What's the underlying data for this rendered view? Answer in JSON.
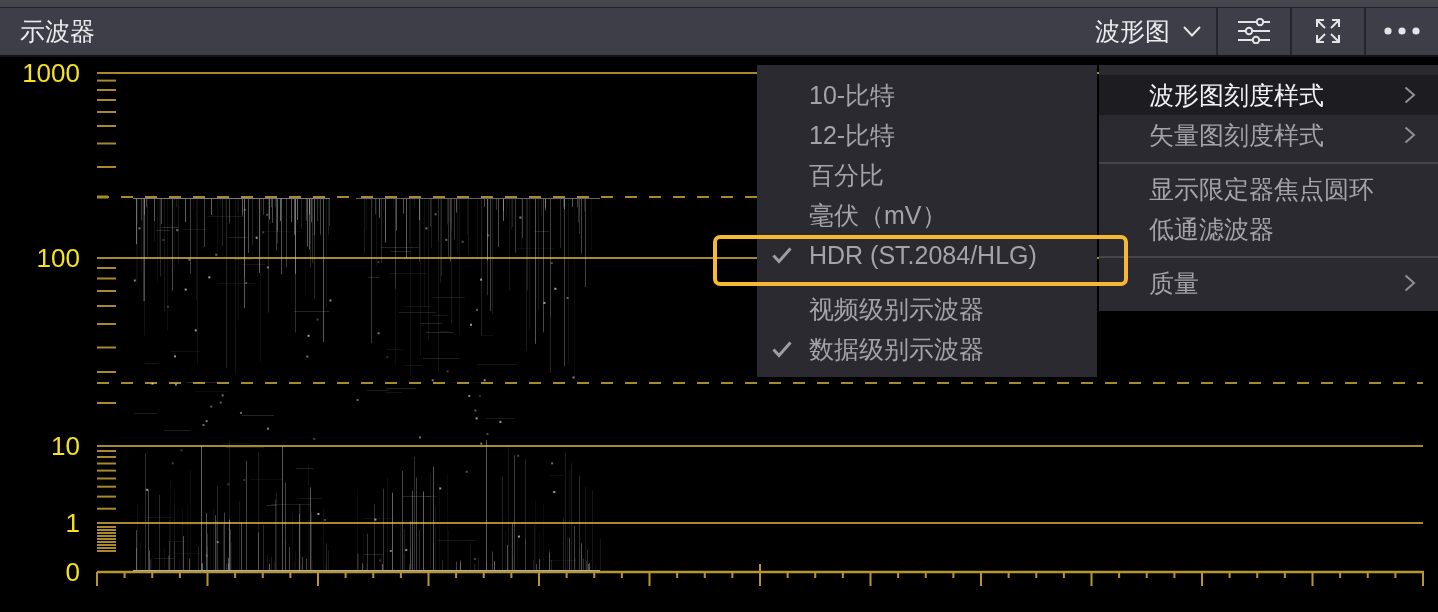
{
  "header": {
    "title": "示波器",
    "view_dropdown": "波形图",
    "buttons": [
      {
        "kind": "settings"
      },
      {
        "kind": "fullscreen"
      },
      {
        "kind": "more"
      }
    ]
  },
  "scope": {
    "scale_labels": [
      "1000",
      "100",
      "10",
      "1",
      "0"
    ]
  },
  "scale_menu": {
    "sections": [
      {
        "items": [
          {
            "label": "10-比特",
            "checked": false,
            "highlighted": false
          },
          {
            "label": "12-比特",
            "checked": false,
            "highlighted": false
          },
          {
            "label": "百分比",
            "checked": false,
            "highlighted": false
          },
          {
            "label": "毫伏（mV）",
            "checked": false,
            "highlighted": false
          },
          {
            "label": "HDR (ST.2084/HLG)",
            "checked": true,
            "highlighted": true
          }
        ]
      },
      {
        "items": [
          {
            "label": "视频级别示波器",
            "checked": false,
            "highlighted": false
          },
          {
            "label": "数据级别示波器",
            "checked": true,
            "highlighted": false
          }
        ]
      }
    ]
  },
  "options_menu": {
    "sections": [
      {
        "items": [
          {
            "label": "波形图刻度样式",
            "submenu": true,
            "selected": true
          },
          {
            "label": "矢量图刻度样式",
            "submenu": true,
            "selected": false
          }
        ]
      },
      {
        "items": [
          {
            "label": "显示限定器焦点圆环",
            "submenu": false,
            "selected": false
          },
          {
            "label": "低通滤波器",
            "submenu": false,
            "selected": false
          }
        ]
      },
      {
        "items": [
          {
            "label": "质量",
            "submenu": true,
            "selected": false
          }
        ]
      }
    ]
  }
}
